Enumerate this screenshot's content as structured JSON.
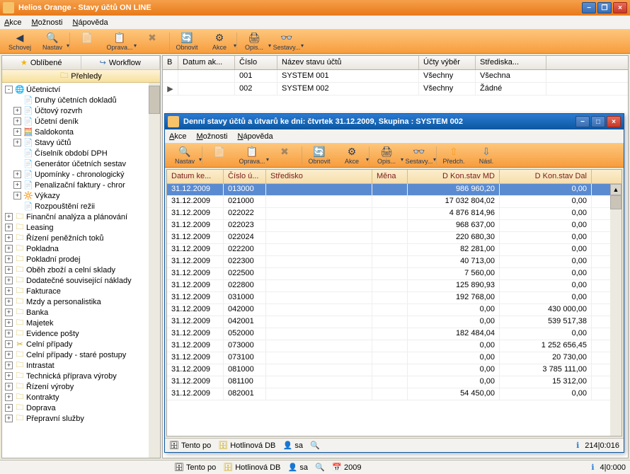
{
  "main": {
    "title": "Helios Orange - Stavy účtů  ON LINE",
    "menu": {
      "akce": "Akce",
      "moznosti": "Možnosti",
      "napoveda": "Nápověda"
    },
    "toolbar": {
      "schovej": "Schovej",
      "nastav": "Nastav",
      "novy": "",
      "oprava": "Oprava...",
      "zrus": "",
      "obnovit": "Obnovit",
      "akce": "Akce",
      "opis": "Opis...",
      "sestavy": "Sestavy..."
    },
    "left": {
      "tab_oblibene": "Oblíbené",
      "tab_workflow": "Workflow",
      "subtab_prehledy": "Přehledy"
    },
    "grid": {
      "headers": {
        "b": "B",
        "datum_ak": "Datum ak...",
        "cislo": "Číslo",
        "nazev": "Název stavu účtů",
        "ucty_vyber": "Účty výběr",
        "strediska": "Střediska..."
      },
      "rows": [
        {
          "cislo": "001",
          "nazev": "SYSTEM 001",
          "vyber": "Všechny",
          "stred": "Všechna"
        },
        {
          "cislo": "002",
          "nazev": "SYSTEM 002",
          "vyber": "Všechny",
          "stred": "Žádné"
        }
      ]
    },
    "status": {
      "tentopo": "Tento po",
      "hotlinova": "Hotlinová DB",
      "sa": "sa",
      "year": "2009",
      "counter": "4|0:000"
    }
  },
  "tree": [
    {
      "d": 0,
      "pm": "-",
      "ic": "🌐",
      "lbl": "Účetnictví"
    },
    {
      "d": 1,
      "pm": " ",
      "ic": "📄",
      "lbl": "Druhy účetních dokladů"
    },
    {
      "d": 1,
      "pm": "+",
      "ic": "📄",
      "lbl": "Účtový rozvrh"
    },
    {
      "d": 1,
      "pm": "+",
      "ic": "📄",
      "lbl": "Účetní deník"
    },
    {
      "d": 1,
      "pm": "+",
      "ic": "🧮",
      "lbl": "Saldokonta"
    },
    {
      "d": 1,
      "pm": "+",
      "ic": "📄",
      "lbl": "Stavy účtů"
    },
    {
      "d": 1,
      "pm": " ",
      "ic": "📄",
      "lbl": "Číselník období DPH"
    },
    {
      "d": 1,
      "pm": " ",
      "ic": "📄",
      "lbl": "Generátor účetních sestav"
    },
    {
      "d": 1,
      "pm": "+",
      "ic": "📄",
      "lbl": "Upomínky - chronologický"
    },
    {
      "d": 1,
      "pm": "+",
      "ic": "📄",
      "lbl": "Penalizační faktury - chror"
    },
    {
      "d": 1,
      "pm": "+",
      "ic": "🔆",
      "lbl": "Výkazy"
    },
    {
      "d": 1,
      "pm": " ",
      "ic": "📄",
      "lbl": "Rozpouštění režii"
    },
    {
      "d": 0,
      "pm": "+",
      "ic": "🗀",
      "lbl": "Finanční analýza a plánování"
    },
    {
      "d": 0,
      "pm": "+",
      "ic": "🗀",
      "lbl": "Leasing"
    },
    {
      "d": 0,
      "pm": "+",
      "ic": "🗀",
      "lbl": "Řízení peněžních toků"
    },
    {
      "d": 0,
      "pm": "+",
      "ic": "🗀",
      "lbl": "Pokladna"
    },
    {
      "d": 0,
      "pm": "+",
      "ic": "🗀",
      "lbl": "Pokladní prodej"
    },
    {
      "d": 0,
      "pm": "+",
      "ic": "🗀",
      "lbl": "Oběh zboží a celní sklady"
    },
    {
      "d": 0,
      "pm": "+",
      "ic": "🗀",
      "lbl": "Dodatečné související náklady"
    },
    {
      "d": 0,
      "pm": "+",
      "ic": "🗀",
      "lbl": "Fakturace"
    },
    {
      "d": 0,
      "pm": "+",
      "ic": "🗀",
      "lbl": "Mzdy a personalistika"
    },
    {
      "d": 0,
      "pm": "+",
      "ic": "🗀",
      "lbl": "Banka"
    },
    {
      "d": 0,
      "pm": "+",
      "ic": "🗀",
      "lbl": "Majetek"
    },
    {
      "d": 0,
      "pm": "+",
      "ic": "🗀",
      "lbl": "Evidence pošty"
    },
    {
      "d": 0,
      "pm": "+",
      "ic": "✂",
      "lbl": "Celní případy"
    },
    {
      "d": 0,
      "pm": "+",
      "ic": "🗀",
      "lbl": "Celní případy - staré postupy"
    },
    {
      "d": 0,
      "pm": "+",
      "ic": "🗀",
      "lbl": "Intrastat"
    },
    {
      "d": 0,
      "pm": "+",
      "ic": "🗀",
      "lbl": "Technická příprava výroby"
    },
    {
      "d": 0,
      "pm": "+",
      "ic": "🗀",
      "lbl": "Řízení výroby"
    },
    {
      "d": 0,
      "pm": "+",
      "ic": "🗀",
      "lbl": "Kontrakty"
    },
    {
      "d": 0,
      "pm": "+",
      "ic": "🗀",
      "lbl": "Doprava"
    },
    {
      "d": 0,
      "pm": "+",
      "ic": "🗀",
      "lbl": "Přepravní služby"
    }
  ],
  "dialog": {
    "title": "Denní stavy účtů a útvarů ke dni: čtvrtek 31.12.2009, Skupina : SYSTEM 002",
    "menu": {
      "akce": "Akce",
      "moznosti": "Možnosti",
      "napoveda": "Nápověda"
    },
    "toolbar": {
      "nastav": "Nastav",
      "oprava": "Oprava...",
      "obnovit": "Obnovit",
      "akce": "Akce",
      "opis": "Opis...",
      "sestavy": "Sestavy...",
      "predch": "Předch.",
      "nasl": "Násl."
    },
    "headers": {
      "datum": "Datum ke...",
      "cislo": "Číslo ú...",
      "stredisko": "Středisko",
      "mena": "Měna",
      "md": "D Kon.stav MD",
      "dal": "D Kon.stav Dal"
    },
    "rows": [
      {
        "d": "31.12.2009",
        "c": "013000",
        "md": "986 960,20",
        "dal": "0,00",
        "sel": true
      },
      {
        "d": "31.12.2009",
        "c": "021000",
        "md": "17 032 804,02",
        "dal": "0,00"
      },
      {
        "d": "31.12.2009",
        "c": "022022",
        "md": "4 876 814,96",
        "dal": "0,00"
      },
      {
        "d": "31.12.2009",
        "c": "022023",
        "md": "968 637,00",
        "dal": "0,00"
      },
      {
        "d": "31.12.2009",
        "c": "022024",
        "md": "220 680,30",
        "dal": "0,00"
      },
      {
        "d": "31.12.2009",
        "c": "022200",
        "md": "82 281,00",
        "dal": "0,00"
      },
      {
        "d": "31.12.2009",
        "c": "022300",
        "md": "40 713,00",
        "dal": "0,00"
      },
      {
        "d": "31.12.2009",
        "c": "022500",
        "md": "7 560,00",
        "dal": "0,00"
      },
      {
        "d": "31.12.2009",
        "c": "022800",
        "md": "125 890,93",
        "dal": "0,00"
      },
      {
        "d": "31.12.2009",
        "c": "031000",
        "md": "192 768,00",
        "dal": "0,00"
      },
      {
        "d": "31.12.2009",
        "c": "042000",
        "md": "0,00",
        "dal": "430 000,00"
      },
      {
        "d": "31.12.2009",
        "c": "042001",
        "md": "0,00",
        "dal": "539 517,38"
      },
      {
        "d": "31.12.2009",
        "c": "052000",
        "md": "182 484,04",
        "dal": "0,00"
      },
      {
        "d": "31.12.2009",
        "c": "073000",
        "md": "0,00",
        "dal": "1 252 656,45"
      },
      {
        "d": "31.12.2009",
        "c": "073100",
        "md": "0,00",
        "dal": "20 730,00"
      },
      {
        "d": "31.12.2009",
        "c": "081000",
        "md": "0,00",
        "dal": "3 785 111,00"
      },
      {
        "d": "31.12.2009",
        "c": "081100",
        "md": "0,00",
        "dal": "15 312,00"
      },
      {
        "d": "31.12.2009",
        "c": "082001",
        "md": "54 450,00",
        "dal": "0,00"
      }
    ],
    "status": {
      "tentopo": "Tento po",
      "hotlinova": "Hotlinová DB",
      "sa": "sa",
      "counter": "214|0:016"
    }
  }
}
